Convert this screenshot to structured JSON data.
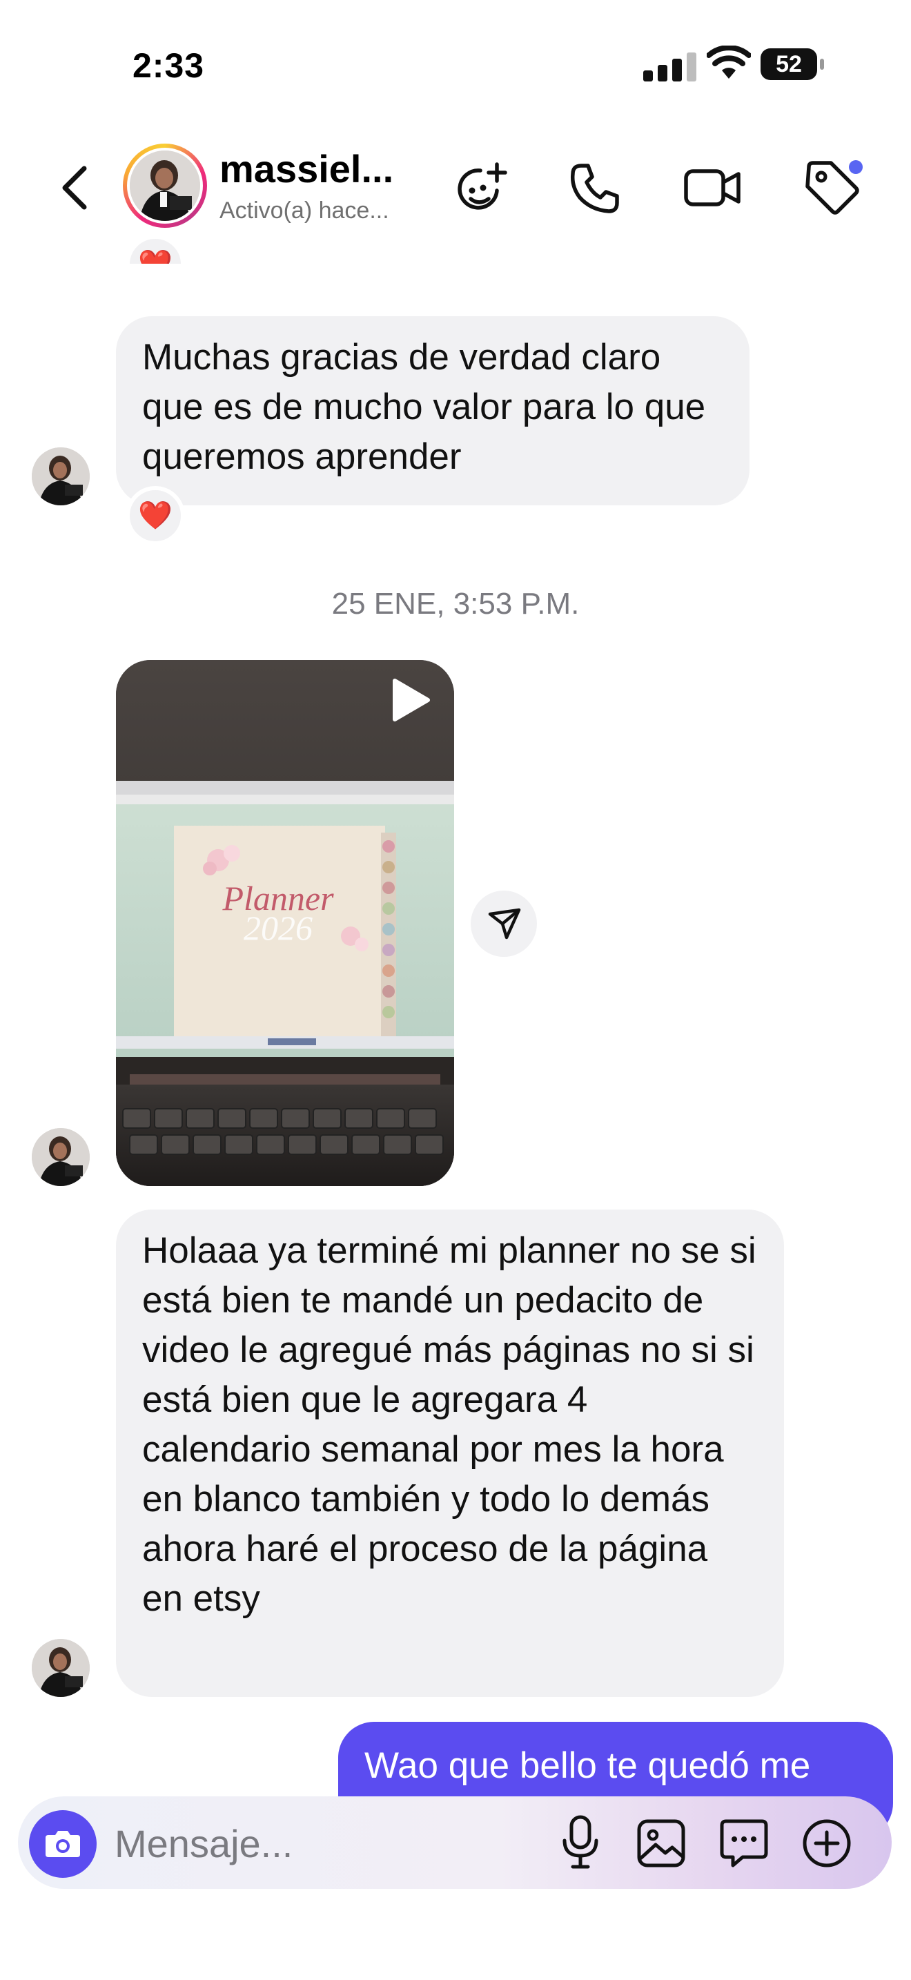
{
  "status_bar": {
    "time": "2:33",
    "battery": "52"
  },
  "header": {
    "contact_name": "massiel...",
    "activity": "Activo(a) hace...",
    "icons": [
      "back-arrow-icon",
      "effects-icon",
      "phone-icon",
      "video-call-icon",
      "tag-icon"
    ]
  },
  "messages": {
    "msg1": "Muchas gracias de verdad claro que es de mucho valor para lo que queremos aprender",
    "reaction": "❤️",
    "date_separator": "25 ENE, 3:53 P.M.",
    "video": {
      "planner_title": "Planner",
      "planner_year": "2026"
    },
    "msg2": "Holaaa ya terminé mi planner no se si está bien te mandé un pedacito de video le agregué más páginas no si si está bien que le agregara 4 calendario semanal por mes la hora en blanco también y todo lo demás ahora haré el proceso de la página en etsy",
    "msg3_partial": "Wao que bello te quedó me"
  },
  "composer": {
    "placeholder": "Mensaje...",
    "icons": [
      "camera-icon",
      "microphone-icon",
      "gallery-icon",
      "sticker-icon",
      "plus-icon"
    ]
  },
  "colors": {
    "accent": "#5b4cf0",
    "bubble_in": "#f1f1f3",
    "notification_dot": "#5865f2"
  }
}
